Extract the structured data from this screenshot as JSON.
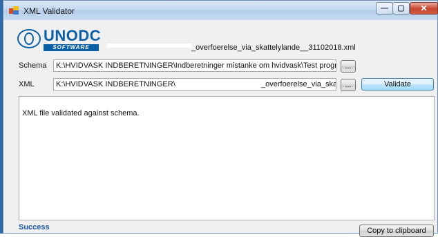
{
  "window": {
    "title": "XML Validator",
    "controls": {
      "minimize": "—",
      "maximize": "▢",
      "close": "✕"
    }
  },
  "logo": {
    "brand": "UNODC",
    "sub": "SOFTWARE"
  },
  "header": {
    "filename": "_overfoerelse_via_skattelylande__31102018.xml"
  },
  "schema": {
    "label": "Schema",
    "value": "K:\\HVIDVASK INDBERETNINGER\\Indberetninger mistanke om hvidvask\\Test progr",
    "browse": "..."
  },
  "xml": {
    "label": "XML",
    "value": "K:\\HVIDVASK INDBERETNINGER\\",
    "value_suffix": "_overfoerelse_via_ska",
    "browse": "...",
    "validate": "Validate"
  },
  "result": {
    "text": "XML file validated against schema."
  },
  "footer": {
    "status": "Success",
    "copy": "Copy to clipboard"
  },
  "colors": {
    "accent": "#0a5fa6",
    "status": "#1a57a6"
  }
}
